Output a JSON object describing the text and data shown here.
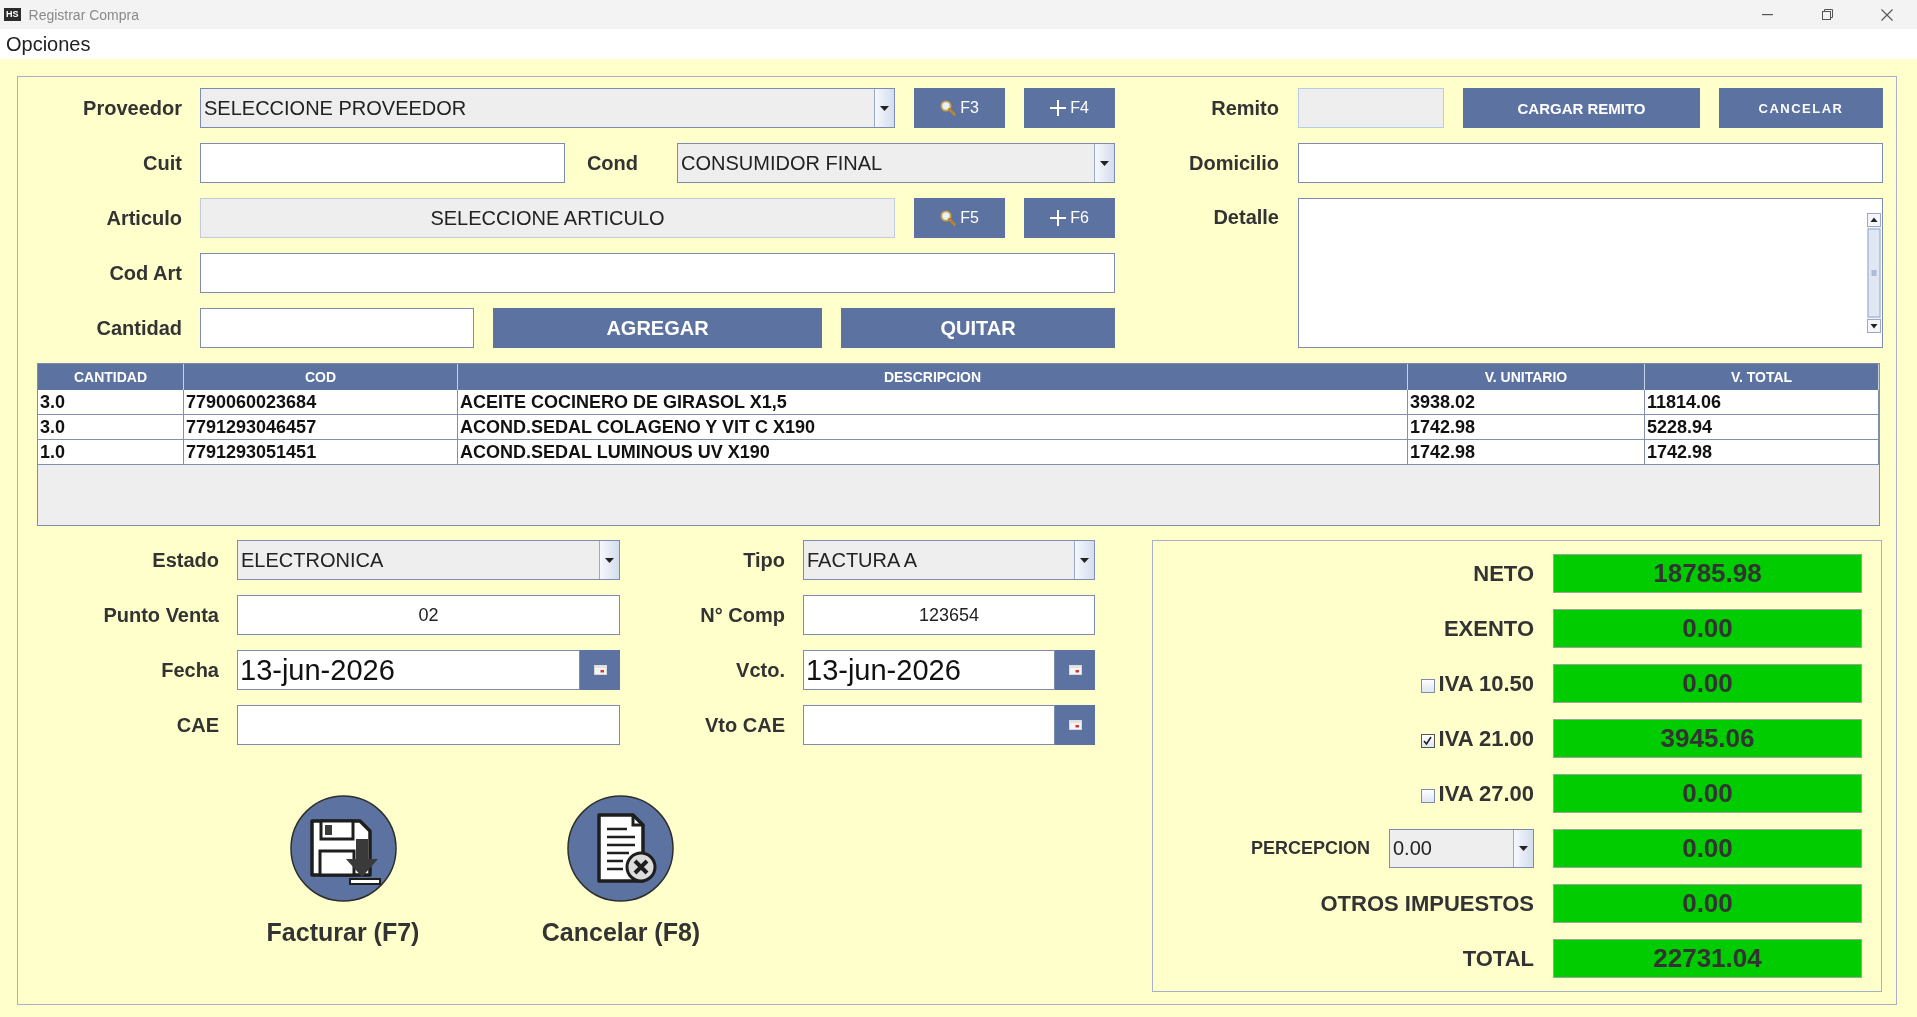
{
  "window": {
    "icon_text": "HS",
    "title": "Registrar Compra"
  },
  "menu": [
    "Opciones"
  ],
  "supplier_form": {
    "proveedor": {
      "label": "Proveedor",
      "value": "SELECCIONE PROVEEDOR",
      "buttons": [
        {
          "kind": "search",
          "label": "F3"
        },
        {
          "kind": "add",
          "label": "F4"
        }
      ]
    },
    "cuit": {
      "label": "Cuit"
    },
    "cond": {
      "label": "Cond",
      "value": "CONSUMIDOR FINAL"
    },
    "articulo": {
      "label": "Articulo",
      "value": "SELECCIONE ARTICULO",
      "buttons": [
        {
          "kind": "search",
          "label": "F5"
        },
        {
          "kind": "add",
          "label": "F6"
        }
      ]
    },
    "cod_art": {
      "label": "Cod Art"
    },
    "cantidad": {
      "label": "Cantidad"
    },
    "buttons": [
      "AGREGAR",
      "QUITAR"
    ]
  },
  "remito_form": {
    "remito": {
      "label": "Remito",
      "disabled": true
    },
    "buttons": [
      "CARGAR REMITO",
      "CANCELAR"
    ],
    "domicilio": {
      "label": "Domicilio"
    },
    "detalle": {
      "label": "Detalle"
    }
  },
  "table": {
    "columns": [
      "CANTIDAD",
      "COD",
      "DESCRIPCION",
      "V. UNITARIO",
      "V. TOTAL"
    ],
    "rows": [
      [
        "3.0",
        "7790060023684",
        "ACEITE COCINERO DE GIRASOL X1,5",
        "3938.02",
        "11814.06"
      ],
      [
        "3.0",
        "7791293046457",
        "ACOND.SEDAL COLAGENO Y VIT C X190",
        "1742.98",
        "5228.94"
      ],
      [
        "1.0",
        "7791293051451",
        "ACOND.SEDAL LUMINOUS UV X190",
        "1742.98",
        "1742.98"
      ]
    ]
  },
  "invoice": {
    "estado": {
      "label": "Estado",
      "value": "ELECTRONICA"
    },
    "tipo": {
      "label": "Tipo",
      "value": "FACTURA A"
    },
    "punto_venta": {
      "label": "Punto Venta",
      "value": "02"
    },
    "n_comp": {
      "label": "N° Comp",
      "value": "123654"
    },
    "fecha": {
      "label": "Fecha",
      "value": "13-jun-2026"
    },
    "vcto": {
      "label": "Vcto.",
      "value": "13-jun-2026"
    },
    "cae": {
      "label": "CAE"
    },
    "vto_cae": {
      "label": "Vto CAE"
    }
  },
  "actions": [
    {
      "kind": "save",
      "label": "Facturar (F7)"
    },
    {
      "kind": "cancel",
      "label": "Cancelar (F8)"
    }
  ],
  "totals": [
    {
      "kind": "plain",
      "label": "NETO",
      "value": "18785.98"
    },
    {
      "kind": "plain",
      "label": "EXENTO",
      "value": "0.00"
    },
    {
      "kind": "checkbox",
      "label": "IVA 10.50",
      "checked": false,
      "value": "0.00"
    },
    {
      "kind": "checkbox",
      "label": "IVA 21.00",
      "checked": true,
      "value": "3945.06"
    },
    {
      "kind": "checkbox",
      "label": "IVA 27.00",
      "checked": false,
      "value": "0.00"
    },
    {
      "kind": "select",
      "label": "PERCEPCION",
      "option": "0.00",
      "value": "0.00"
    },
    {
      "kind": "plain",
      "label": "OTROS IMPUESTOS",
      "value": "0.00"
    },
    {
      "kind": "plain",
      "label": "TOTAL",
      "value": "22731.04"
    }
  ]
}
